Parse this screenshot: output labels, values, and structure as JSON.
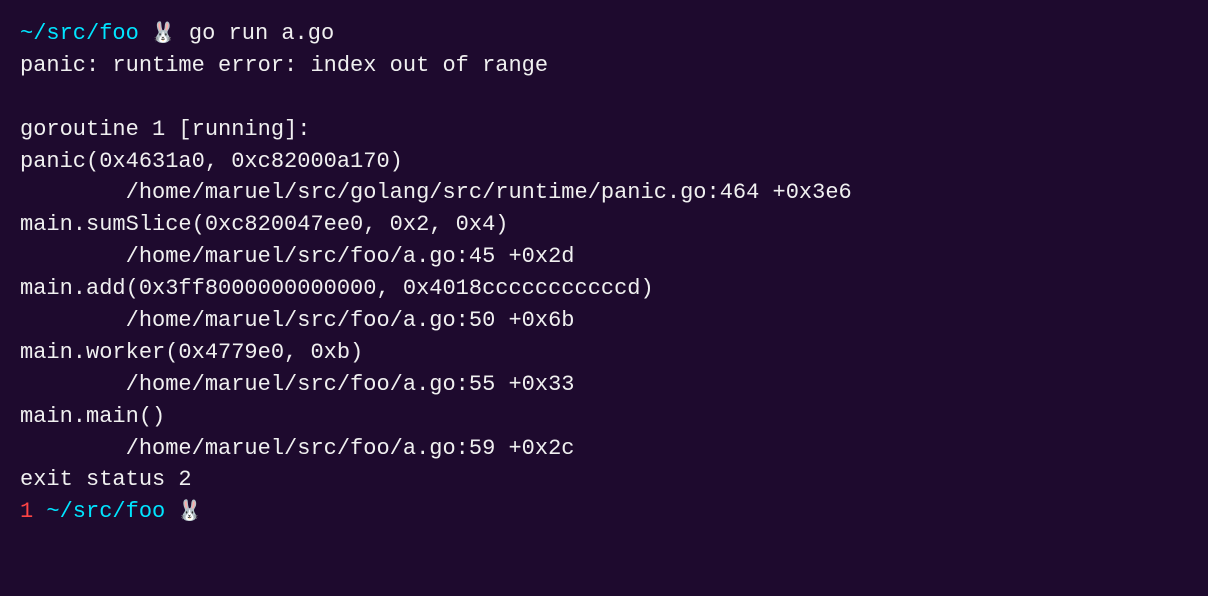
{
  "terminal": {
    "bg_color": "#1e0a2e",
    "lines": [
      {
        "type": "prompt",
        "path": "~/src/foo",
        "rabbit": "🐰",
        "cmd": " go run a.go"
      },
      {
        "type": "output",
        "text": "panic: runtime error: index out of range"
      },
      {
        "type": "blank"
      },
      {
        "type": "output",
        "text": "goroutine 1 [running]:"
      },
      {
        "type": "output",
        "text": "panic(0x4631a0, 0xc82000a170)"
      },
      {
        "type": "output",
        "text": "        /home/maruel/src/golang/src/runtime/panic.go:464 +0x3e6"
      },
      {
        "type": "output",
        "text": "main.sumSlice(0xc820047ee0, 0x2, 0x4)"
      },
      {
        "type": "output",
        "text": "        /home/maruel/src/foo/a.go:45 +0x2d"
      },
      {
        "type": "output",
        "text": "main.add(0x3ff8000000000000, 0x4018cccccccccccd)"
      },
      {
        "type": "output",
        "text": "        /home/maruel/src/foo/a.go:50 +0x6b"
      },
      {
        "type": "output",
        "text": "main.worker(0x4779e0, 0xb)"
      },
      {
        "type": "output",
        "text": "        /home/maruel/src/foo/a.go:55 +0x33"
      },
      {
        "type": "output",
        "text": "main.main()"
      },
      {
        "type": "output",
        "text": "        /home/maruel/src/foo/a.go:59 +0x2c"
      },
      {
        "type": "output",
        "text": "exit status 2"
      },
      {
        "type": "prompt2",
        "num": "1",
        "path": " ~/src/foo",
        "rabbit": "🐰"
      }
    ]
  }
}
